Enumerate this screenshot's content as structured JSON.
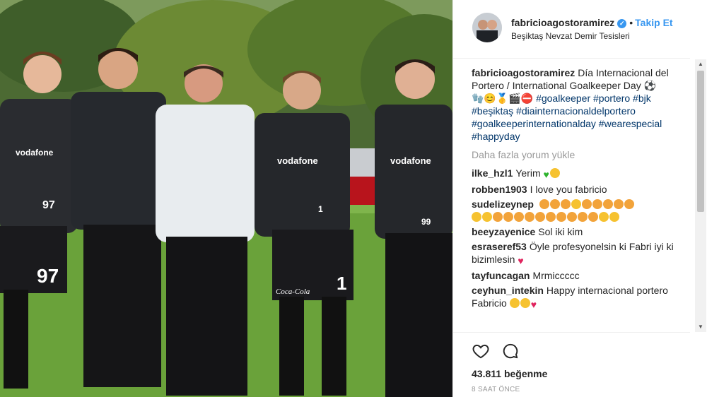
{
  "post": {
    "username": "fabricioagostoramirez",
    "separator": "•",
    "follow_label": "Takip Et",
    "location": "Beşiktaş Nevzat Demir Tesisleri",
    "caption": {
      "username": "fabricioagostoramirez",
      "text": "Día Internacional del Portero / International Goalkeeper Day",
      "hashtags_line1": "#goalkeeper #portero #bjk",
      "hashtags_line2": "#beşiktaş #diainternacionaldelportero",
      "hashtags_line3": "#goalkeeperinternationalday #wearespecial",
      "hashtags_line4": "#happyday"
    },
    "load_more_label": "Daha fazla yorum yükle",
    "comments": [
      {
        "user": "ilke_hzl1",
        "text": "Yerim"
      },
      {
        "user": "robben1903",
        "text": "I love you fabricio"
      },
      {
        "user": "sudelizeynep",
        "text": ""
      },
      {
        "user": "beeyzayenice",
        "text": "Sol iki kim"
      },
      {
        "user": "esraseref53",
        "text": "Öyle profesyonelsin ki Fabri iyi ki bizimlesin"
      },
      {
        "user": "tayfuncagan",
        "text": "Mrmiccccc"
      },
      {
        "user": "ceyhun_intekin",
        "text": "Happy internacional portero Fabricio"
      }
    ],
    "likes_label": "43.811 beğenme",
    "time_label": "8 SAAT ÖNCE"
  },
  "photo": {
    "jersey_sponsor": "vodafone",
    "shorts_sponsor": "Coca-Cola",
    "numbers": [
      "97",
      "97",
      "1",
      "1",
      "99"
    ]
  },
  "icons": {
    "verified": "verified-badge-icon",
    "like": "heart-outline-icon",
    "comment": "speech-bubble-icon"
  },
  "colors": {
    "link": "#3897f0",
    "hashtag": "#003569",
    "text": "#262626",
    "muted": "#999999",
    "grass": "#6aa23a",
    "kit": "#1c1c1f"
  }
}
